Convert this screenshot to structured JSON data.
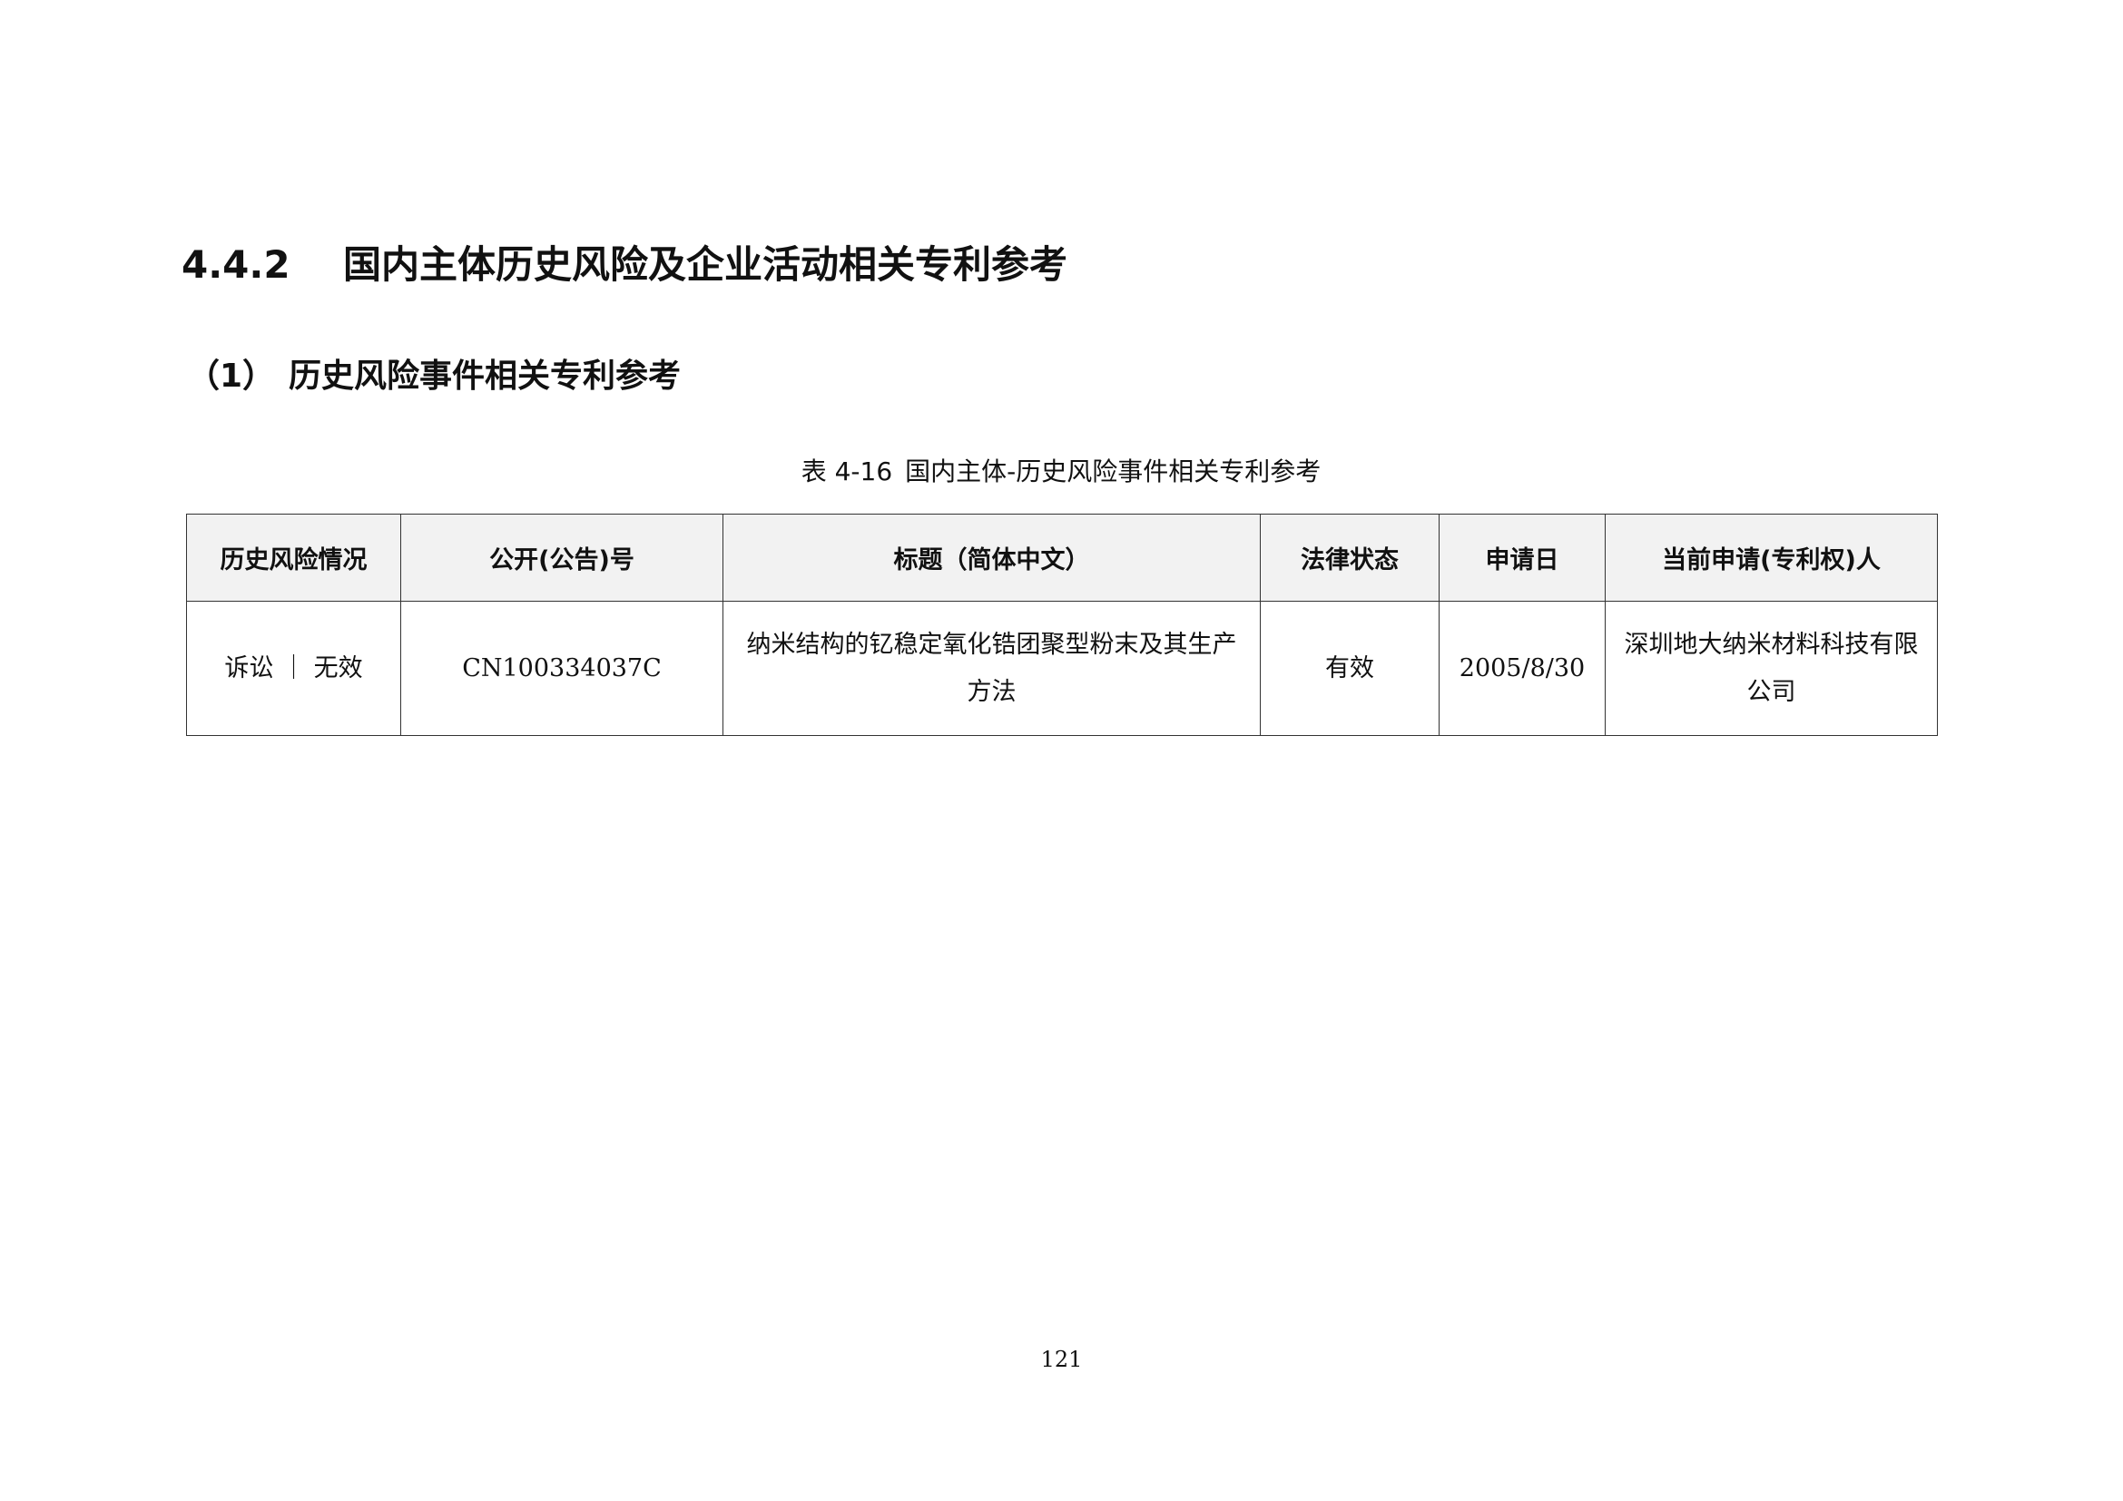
{
  "section": {
    "number": "4.4.2",
    "title": "国内主体历史风险及企业活动相关专利参考"
  },
  "subsection": {
    "number": "（1）",
    "title": "历史风险事件相关专利参考"
  },
  "table_caption": {
    "label": "表 4-16",
    "title": "国内主体-历史风险事件相关专利参考"
  },
  "table": {
    "headers": [
      "历史风险情况",
      "公开(公告)号",
      "标题（简体中文）",
      "法律状态",
      "申请日",
      "当前申请(专利权)人"
    ],
    "rows": [
      [
        "诉讼 ｜ 无效",
        "CN100334037C",
        "纳米结构的钇稳定氧化锆团聚型粉末及其生产方法",
        "有效",
        "2005/8/30",
        "深圳地大纳米材料科技有限公司"
      ]
    ]
  },
  "page_number": "121"
}
